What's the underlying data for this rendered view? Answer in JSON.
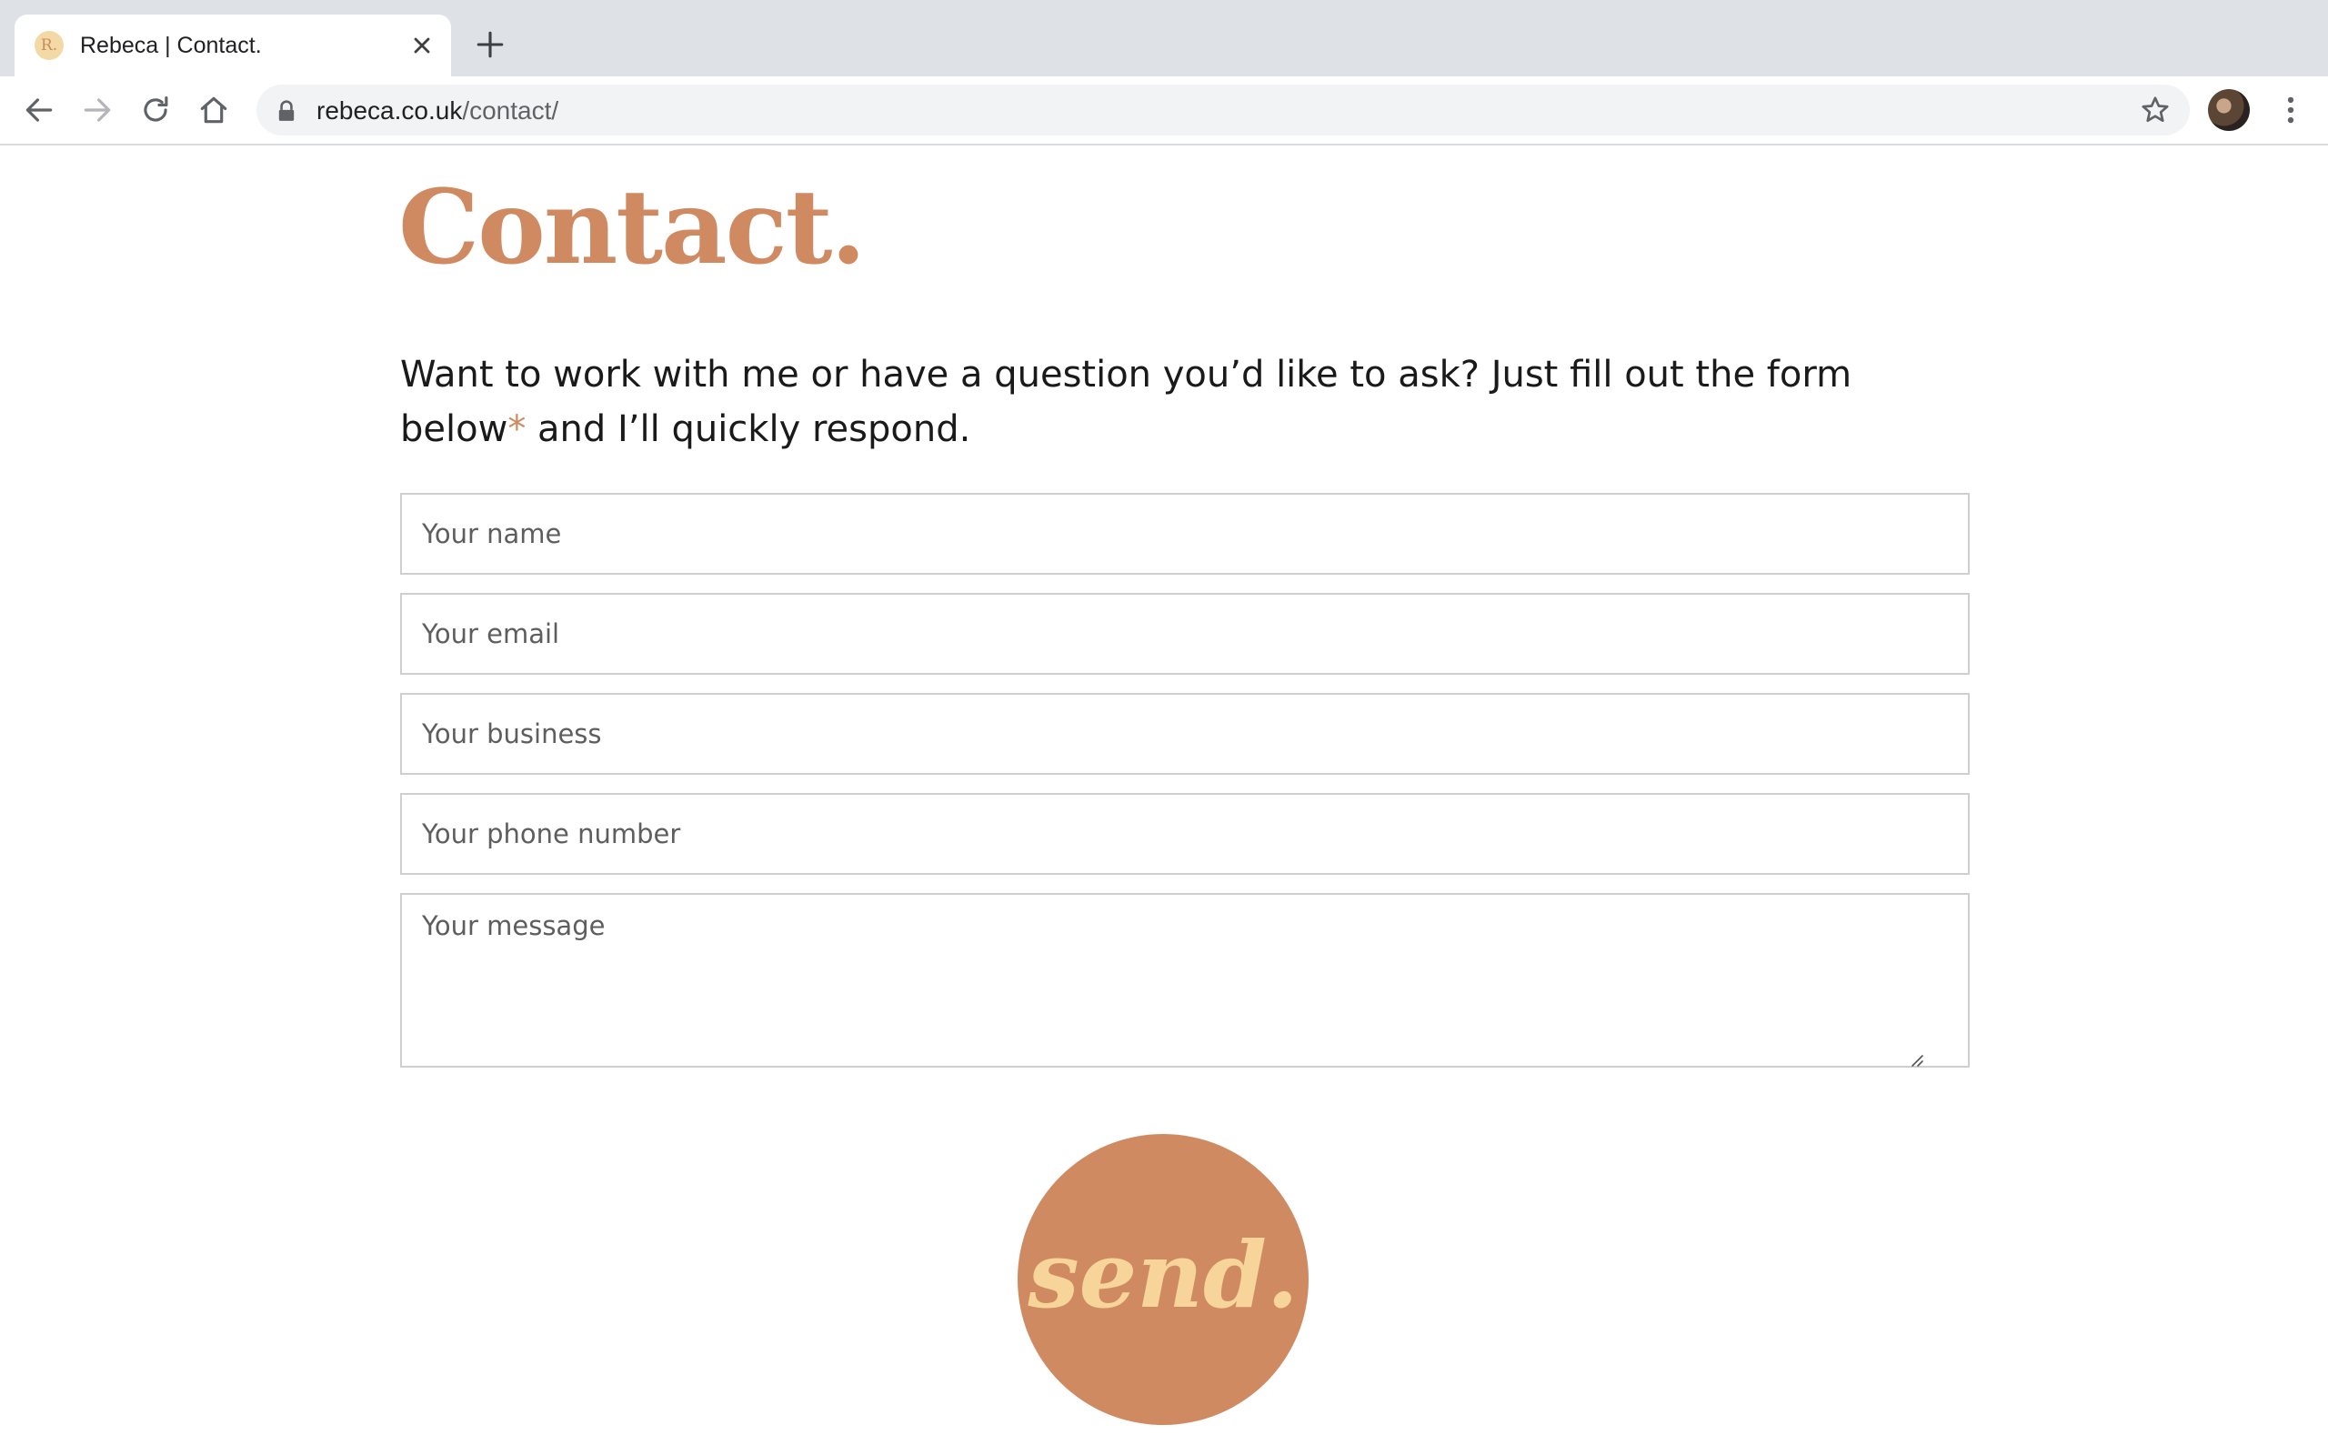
{
  "browser": {
    "tab": {
      "favicon_text": "R.",
      "title": "Rebeca | Contact."
    },
    "address_bar": {
      "host": "rebeca.co.uk",
      "path": "/contact/"
    },
    "icons": {
      "back": "back-arrow-icon",
      "forward": "forward-arrow-icon",
      "reload": "reload-icon",
      "home": "home-icon",
      "lock": "lock-icon",
      "bookmark": "star-icon",
      "menu": "kebab-menu-icon",
      "close_tab": "close-icon",
      "new_tab": "plus-icon"
    }
  },
  "page": {
    "title": "Contact.",
    "intro_text": "Want to work with me or have a question you’d like to ask? Just fill out the form below",
    "intro_asterisk": "*",
    "intro_text_end": " and I’ll quickly respond.",
    "form": {
      "name_placeholder": "Your name",
      "email_placeholder": "Your email",
      "business_placeholder": "Your business",
      "phone_placeholder": "Your phone number",
      "message_placeholder": "Your message",
      "submit_label": "send."
    }
  },
  "colors": {
    "accent": "#cf8a62",
    "button_text": "#f6d49a",
    "chrome_bg": "#dee1e6",
    "omnibox_bg": "#f1f3f4",
    "field_border": "#cfcfcf"
  }
}
